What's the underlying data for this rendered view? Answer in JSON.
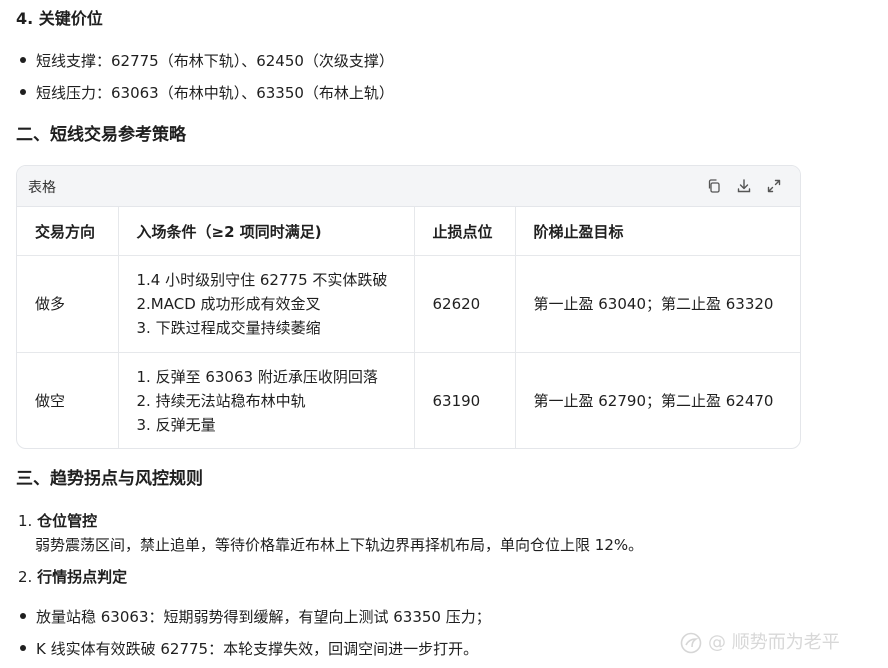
{
  "section4": {
    "heading": "4. 关键价位",
    "items": [
      "短线支撑：62775（布林下轨）、62450（次级支撑）",
      "短线压力：63063（布林中轨）、63350（布林上轨）"
    ]
  },
  "section2": {
    "heading": "二、短线交易参考策略"
  },
  "table": {
    "title": "表格",
    "tools": [
      "copy-icon",
      "download-icon",
      "expand-icon"
    ],
    "headers": [
      "交易方向",
      "入场条件（≥2 项同时满足)",
      "止损点位",
      "阶梯止盈目标"
    ],
    "rows": [
      {
        "direction": "做多",
        "conditions": [
          "1.4 小时级别守住 62775 不实体跌破",
          "2.MACD 成功形成有效金叉",
          "3. 下跌过程成交量持续萎缩"
        ],
        "stop": "62620",
        "targets": "第一止盈 63040；第二止盈 63320"
      },
      {
        "direction": "做空",
        "conditions": [
          "1. 反弹至 63063 附近承压收阴回落",
          "2. 持续无法站稳布林中轨",
          "3. 反弹无量"
        ],
        "stop": "63190",
        "targets": "第一止盈 62790；第二止盈 62470"
      }
    ]
  },
  "section3": {
    "heading": "三、趋势拐点与风控规则",
    "item1": {
      "number": "1.",
      "title": "仓位管控",
      "text": "弱势震荡区间，禁止追单，等待价格靠近布林上下轨边界再择机布局，单向仓位上限 12%。"
    },
    "item2": {
      "number": "2.",
      "title": "行情拐点判定"
    },
    "bullets": [
      "放量站稳 63063：短期弱势得到缓解，有望向上测试 63350 压力；",
      "K 线实体有效跌破 62775：本轮支撑失效，回调空间进一步打开。"
    ]
  },
  "watermark": "@ 顺势而为老平"
}
